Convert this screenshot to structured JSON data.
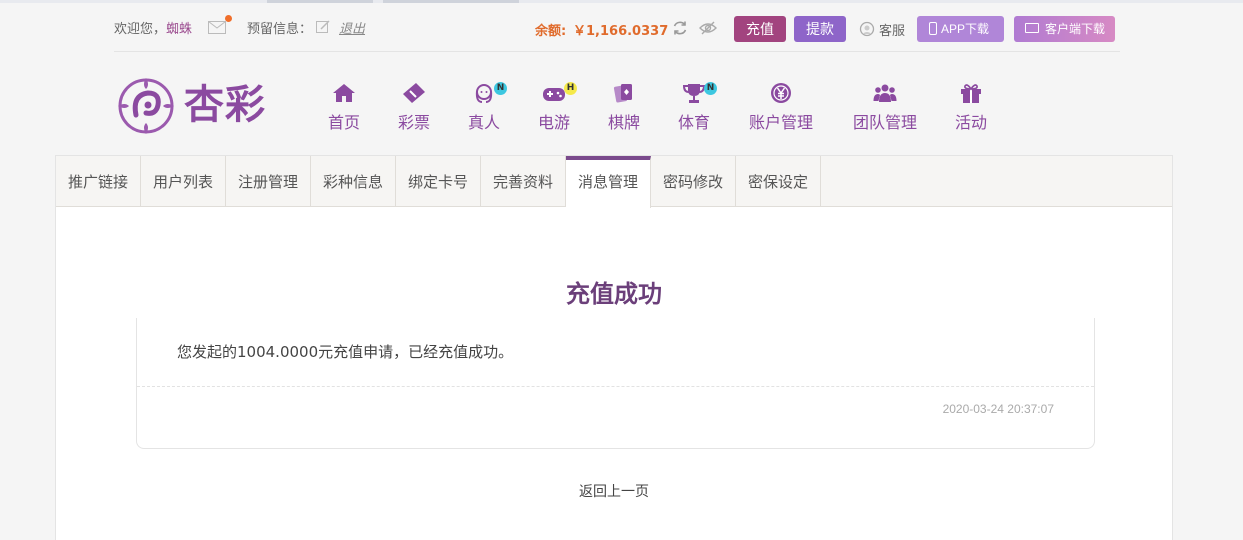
{
  "topbar": {
    "welcome": "欢迎您，",
    "username": "蜘蛛",
    "reserved_info": "预留信息：",
    "logout": "退出",
    "balance_label": "余额:",
    "balance_value": "￥1,166.0337",
    "recharge": "充值",
    "withdraw": "提款",
    "service": "客服",
    "app_download": "APP下载",
    "client_download": "客户端下载"
  },
  "logo": {
    "text": "杏彩"
  },
  "nav": [
    {
      "label": "首页",
      "icon": "home-icon"
    },
    {
      "label": "彩票",
      "icon": "ticket-icon"
    },
    {
      "label": "真人",
      "icon": "live-dealer-icon",
      "badge": "N"
    },
    {
      "label": "电游",
      "icon": "gamepad-icon",
      "badge": "H"
    },
    {
      "label": "棋牌",
      "icon": "cards-icon"
    },
    {
      "label": "体育",
      "icon": "trophy-icon",
      "badge": "N"
    },
    {
      "label": "账户管理",
      "icon": "yen-icon"
    },
    {
      "label": "团队管理",
      "icon": "team-icon"
    },
    {
      "label": "活动",
      "icon": "gift-icon"
    }
  ],
  "tabs": [
    {
      "label": "推广链接"
    },
    {
      "label": "用户列表"
    },
    {
      "label": "注册管理"
    },
    {
      "label": "彩种信息"
    },
    {
      "label": "绑定卡号"
    },
    {
      "label": "完善资料"
    },
    {
      "label": "消息管理",
      "active": true
    },
    {
      "label": "密码修改"
    },
    {
      "label": "密保设定"
    }
  ],
  "message": {
    "title": "充值成功",
    "body": "您发起的1004.0000元充值申请，已经充值成功。",
    "time": "2020-03-24 20:37:07",
    "back": "返回上一页"
  },
  "colors": {
    "brand": "#8b4aa0",
    "recharge": "#a2447f",
    "withdraw": "#8e65c9",
    "balance": "#e06b2c"
  }
}
